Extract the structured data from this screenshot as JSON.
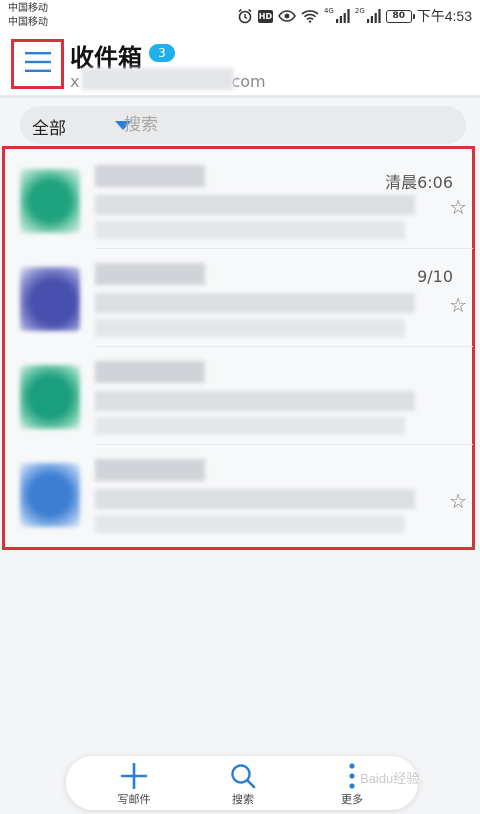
{
  "status_bar": {
    "carrier_1": "中国移动",
    "carrier_2": "中国移动",
    "hd": "HD",
    "net_1": "4G",
    "net_2": "2G",
    "battery": "80",
    "time": "下午4:53"
  },
  "header": {
    "title": "收件箱",
    "unread_count": "3",
    "account_prefix": "x",
    "account_suffix": "com"
  },
  "filter": {
    "label": "全部",
    "search_placeholder": "搜索"
  },
  "mails": [
    {
      "time": "清晨6:06",
      "avatar_color": "#1fa37c"
    },
    {
      "time": "9/10",
      "avatar_color": "#4850ae"
    },
    {
      "time": "",
      "avatar_color": "#1b9e7d"
    },
    {
      "time": "",
      "avatar_color": "#3c7ed2"
    }
  ],
  "toolbar": {
    "compose_label": "写邮件",
    "search_label": "搜索",
    "more_label": "更多"
  },
  "colors": {
    "accent": "#1fb0ec",
    "icon_blue": "#2b7fd6",
    "highlight_red": "#d9303b"
  },
  "watermark": "Baidu经验"
}
